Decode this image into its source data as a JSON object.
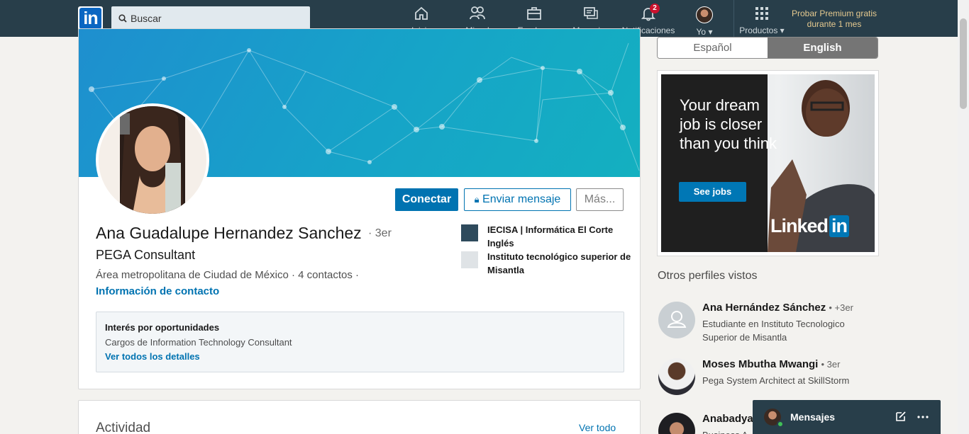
{
  "nav": {
    "search_placeholder": "Buscar",
    "items": [
      {
        "label": "Inicio",
        "icon": "home-icon"
      },
      {
        "label": "Mi red",
        "icon": "people-icon"
      },
      {
        "label": "Empleos",
        "icon": "briefcase-icon"
      },
      {
        "label": "Mensajes",
        "icon": "messages-icon"
      },
      {
        "label": "Notificaciones",
        "icon": "bell-icon",
        "badge": "2"
      },
      {
        "label": "Yo",
        "icon": "avatar"
      },
      {
        "label": "Productos",
        "icon": "grid-icon"
      }
    ],
    "premium": "Probar Premium gratis durante 1 mes"
  },
  "profile": {
    "name": "Ana Guadalupe Hernandez Sanchez",
    "degree": "· 3er",
    "headline": "PEGA Consultant",
    "location": "Área metropolitana de Ciudad de México  ·  4 contactos  ·",
    "contact_link": "Información de contacto",
    "buttons": {
      "connect": "Conectar",
      "message": "Enviar mensaje",
      "more": "Más..."
    },
    "experience": [
      {
        "label": "IECISA | Informática El Corte Inglés"
      },
      {
        "label": "Instituto tecnológico superior de Misantla"
      }
    ],
    "opportunities": {
      "title": "Interés por oportunidades",
      "detail": "Cargos de Information Technology Consultant",
      "link": "Ver todos los detalles"
    }
  },
  "activity": {
    "title": "Actividad",
    "link": "Ver todo"
  },
  "language": {
    "es": "Español",
    "en": "English"
  },
  "ad": {
    "headline": "Your dream job is closer than you think",
    "button": "See jobs",
    "brand": "Linked",
    "brand_in": "in"
  },
  "others": {
    "title": "Otros perfiles vistos",
    "people": [
      {
        "name": "Ana Hernández Sánchez",
        "degree": "• +3er",
        "desc": "Estudiante en Instituto Tecnologico Superior de Misantla"
      },
      {
        "name": "Moses Mbutha Mwangi",
        "degree": "• 3er",
        "desc": "Pega System Architect at SkillStorm"
      },
      {
        "name": "Anabadya",
        "degree": "",
        "desc": "Business A"
      }
    ]
  },
  "messaging": {
    "title": "Mensajes"
  },
  "colors": {
    "nav_bg": "#283e4a",
    "accent": "#0073b1",
    "premium": "#e5c98f"
  }
}
